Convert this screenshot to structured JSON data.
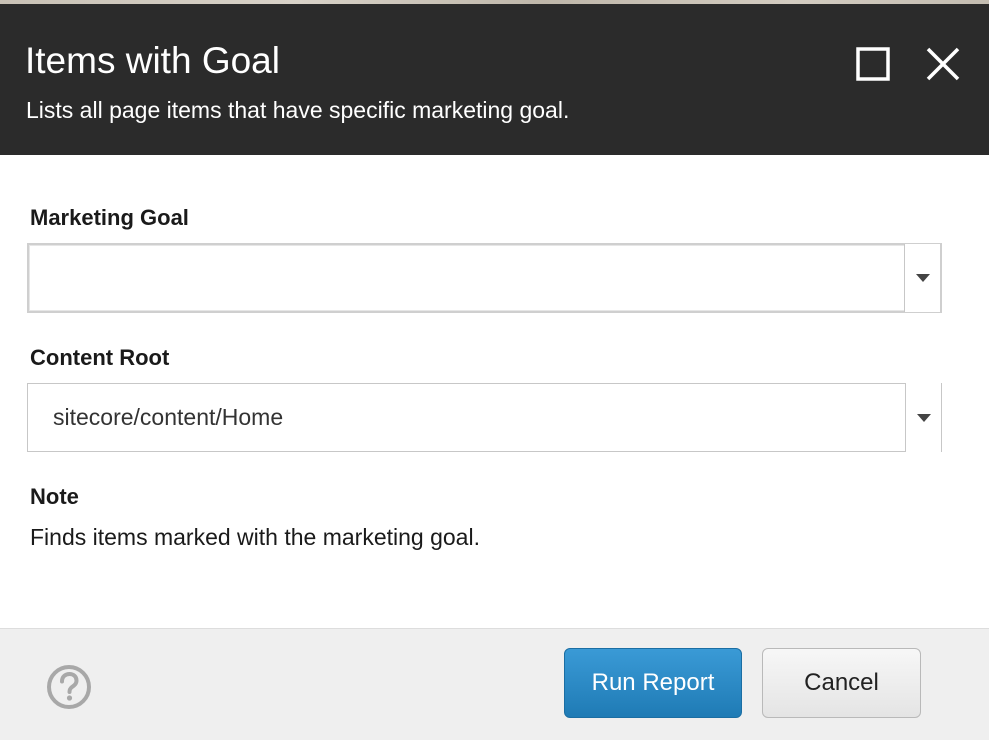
{
  "dialog": {
    "title": "Items with Goal",
    "subtitle": "Lists all page items that have specific marketing goal."
  },
  "header_controls": {
    "maximize_icon": "square-outline-icon",
    "close_icon": "close-x-icon"
  },
  "form": {
    "marketing_goal": {
      "label": "Marketing Goal",
      "value": ""
    },
    "content_root": {
      "label": "Content Root",
      "value": "sitecore/content/Home"
    },
    "note": {
      "label": "Note",
      "text": "Finds items marked with the marketing goal."
    }
  },
  "footer": {
    "help_icon": "help-question-icon",
    "run_label": "Run Report",
    "cancel_label": "Cancel"
  },
  "colors": {
    "header_bg": "#2b2b2b",
    "primary_button": "#2389c5",
    "footer_bg": "#efefef"
  }
}
